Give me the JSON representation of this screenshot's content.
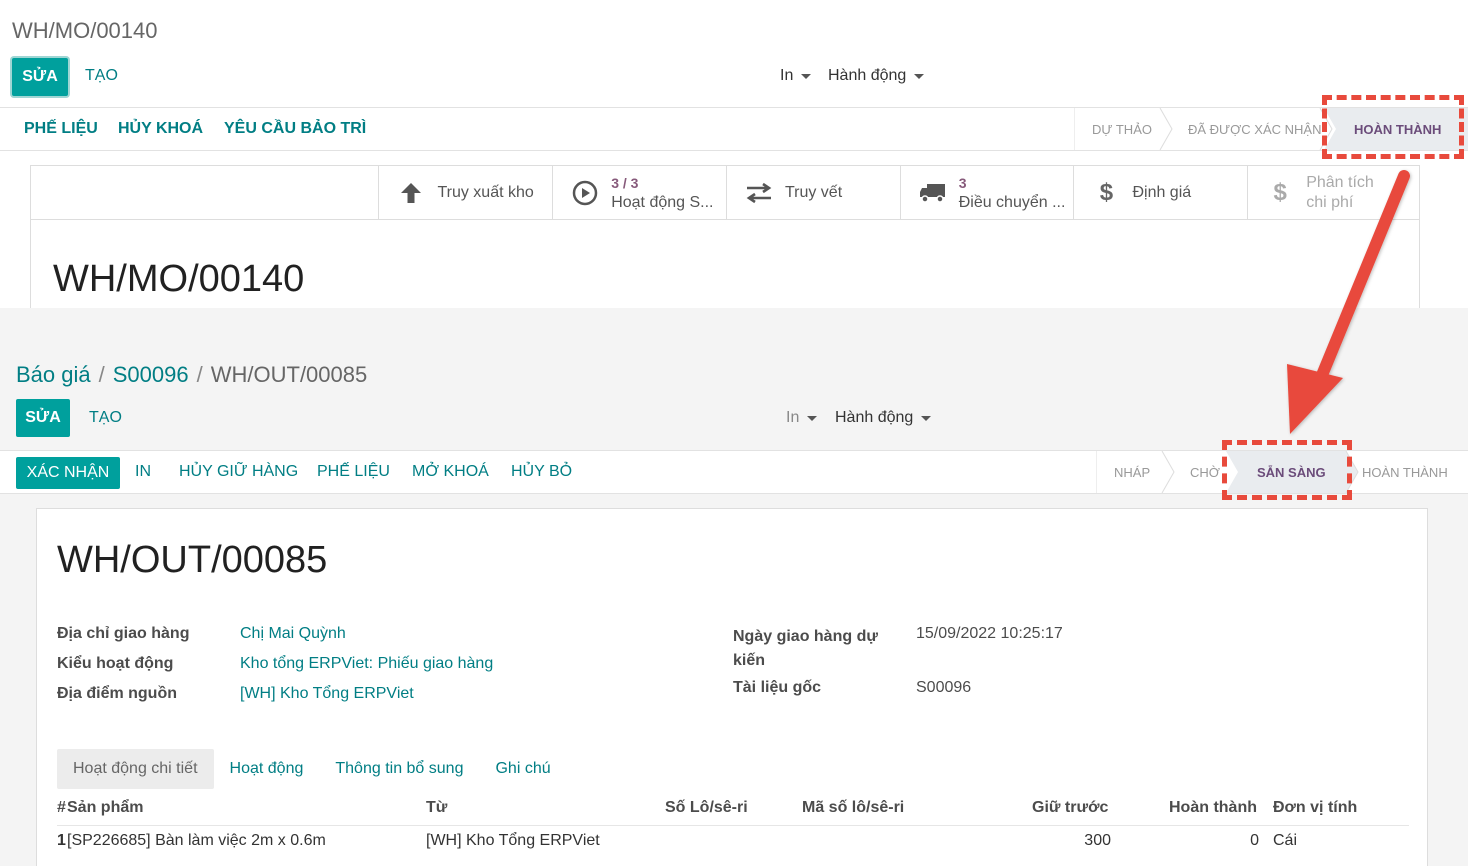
{
  "top": {
    "title": "WH/MO/00140",
    "edit": "SỬA",
    "create": "TẠO",
    "print": "In",
    "action": "Hành động",
    "buttons": [
      "PHẾ LIỆU",
      "HỦY KHOÁ",
      "YÊU CẦU BẢO TRÌ"
    ],
    "stages": [
      "DỰ THẢO",
      "ĐÃ ĐƯỢC XÁC NHẬN",
      "HOÀN THÀNH"
    ],
    "smart": [
      {
        "icon": "arrow-up-icon",
        "count": "",
        "label": "Truy xuất kho"
      },
      {
        "icon": "play-circle-icon",
        "count": "3 / 3",
        "label": "Hoạt động S..."
      },
      {
        "icon": "exchange-icon",
        "count": "",
        "label": "Truy vết"
      },
      {
        "icon": "truck-icon",
        "count": "3",
        "label": "Điều chuyển ..."
      },
      {
        "icon": "dollar-icon",
        "count": "",
        "label": "Định giá"
      },
      {
        "icon": "dollar-icon",
        "count": "",
        "label": "Phân tích chi phí"
      }
    ],
    "doc_title": "WH/MO/00140"
  },
  "bottom": {
    "breadcrumb": [
      "Báo giá",
      "S00096",
      "WH/OUT/00085"
    ],
    "edit": "SỬA",
    "create": "TẠO",
    "print": "In",
    "action": "Hành động",
    "buttons": [
      "XÁC NHẬN",
      "IN",
      "HỦY GIỮ HÀNG",
      "PHẾ LIỆU",
      "MỞ KHOÁ",
      "HỦY BỎ"
    ],
    "stages": [
      "NHÁP",
      "CHỜ",
      "SẴN SÀNG",
      "HOÀN THÀNH"
    ],
    "doc_title": "WH/OUT/00085",
    "fields": {
      "delivery_address_label": "Địa chỉ giao hàng",
      "delivery_address": "Chị Mai Quỳnh",
      "op_type_label": "Kiểu hoạt động",
      "op_type": "Kho tổng ERPViet: Phiếu giao hàng",
      "source_loc_label": "Địa điểm nguồn",
      "source_loc": "[WH] Kho Tổng ERPViet",
      "scheduled_label_1": "Ngày giao hàng dự",
      "scheduled_label_2": "kiến",
      "scheduled": "15/09/2022 10:25:17",
      "origin_label": "Tài liệu gốc",
      "origin": "S00096"
    },
    "tabs": [
      "Hoạt động chi tiết",
      "Hoạt động",
      "Thông tin bổ sung",
      "Ghi chú"
    ],
    "table": {
      "headers": [
        "#",
        "Sản phẩm",
        "Từ",
        "Số Lô/sê-ri",
        "Mã số lô/sê-ri",
        "Giữ trước",
        "Hoàn thành",
        "Đơn vị tính"
      ],
      "rows": [
        {
          "no": "1",
          "product": "[SP226685] Bàn làm việc 2m x 0.6m",
          "from": "[WH] Kho Tổng ERPViet",
          "lot": "",
          "lot_name": "",
          "reserved": "300",
          "done": "0",
          "uom": "Cái"
        }
      ]
    }
  },
  "colors": {
    "accent": "#00a09d",
    "link": "#017e84",
    "highlight": "#e84a3c",
    "active_stage": "#6b4c7a"
  }
}
